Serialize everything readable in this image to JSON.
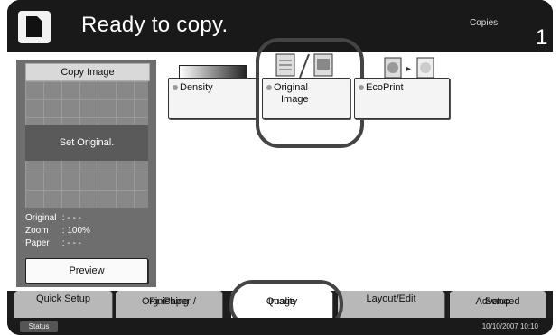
{
  "header": {
    "title": "Ready to copy.",
    "copies_label": "Copies",
    "copies_value": "1"
  },
  "left_panel": {
    "copy_image_label": "Copy Image",
    "message": "Set Original.",
    "info": [
      {
        "label": "Original",
        "value": ":  - - -"
      },
      {
        "label": "Zoom",
        "value": ":  100%"
      },
      {
        "label": "Paper",
        "value": ":  - - -"
      }
    ],
    "preview_label": "Preview"
  },
  "options": {
    "density": "Density",
    "original_image_line1": "Original",
    "original_image_line2": "Image",
    "ecoprint": "EcoPrint"
  },
  "tabs": {
    "quick_setup": "Quick Setup",
    "org_paper_line1": "Org./Paper /",
    "org_paper_line2": "Finishing",
    "image_quality_line1": "Image",
    "image_quality_line2": "Quality",
    "layout_edit": "Layout/Edit",
    "advanced_line1": "Advanced",
    "advanced_line2": "Setup"
  },
  "status_bar": {
    "status_label": "Status",
    "datetime": "10/10/2007   10:10"
  },
  "icons": {
    "document": "document-icon",
    "original_image": "text-photo-icon",
    "ecoprint": "ecoprint-icon"
  }
}
